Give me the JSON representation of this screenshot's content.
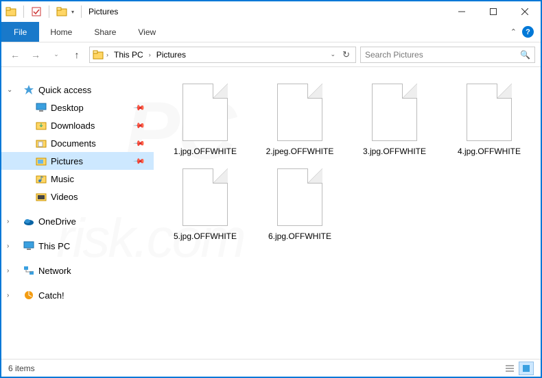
{
  "window": {
    "title": "Pictures",
    "minimize_tooltip": "Minimize",
    "maximize_tooltip": "Maximize",
    "close_tooltip": "Close"
  },
  "ribbon": {
    "file": "File",
    "tabs": [
      "Home",
      "Share",
      "View"
    ]
  },
  "address": {
    "crumbs": [
      "This PC",
      "Pictures"
    ]
  },
  "search": {
    "placeholder": "Search Pictures"
  },
  "nav": {
    "quick_access": "Quick access",
    "items": [
      {
        "label": "Desktop",
        "pinned": true
      },
      {
        "label": "Downloads",
        "pinned": true
      },
      {
        "label": "Documents",
        "pinned": true
      },
      {
        "label": "Pictures",
        "pinned": true,
        "selected": true
      },
      {
        "label": "Music",
        "pinned": false
      },
      {
        "label": "Videos",
        "pinned": false
      }
    ],
    "onedrive": "OneDrive",
    "this_pc": "This PC",
    "network": "Network",
    "catch": "Catch!"
  },
  "files": [
    "1.jpg.OFFWHITE",
    "2.jpeg.OFFWHITE",
    "3.jpg.OFFWHITE",
    "4.jpg.OFFWHITE",
    "5.jpg.OFFWHITE",
    "6.jpg.OFFWHITE"
  ],
  "status": {
    "count": "6 items"
  }
}
